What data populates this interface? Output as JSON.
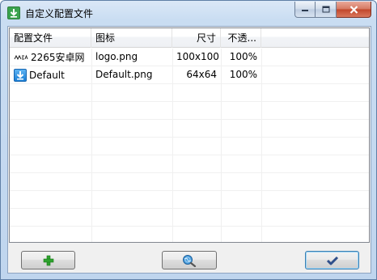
{
  "window": {
    "title": "自定义配置文件"
  },
  "table": {
    "columns": [
      "配置文件",
      "图标",
      "尺寸",
      "不透..."
    ],
    "rows": [
      {
        "name": "2265安卓网",
        "icon_file": "logo.png",
        "size": "100x100",
        "opacity": "100%",
        "icon": "site-logo-icon"
      },
      {
        "name": "Default",
        "icon_file": "Default.png",
        "size": "64x64",
        "opacity": "100%",
        "icon": "blue-download-arrow-icon"
      }
    ]
  },
  "buttons": {
    "add_icon": "green-plus-icon",
    "search_icon": "magnifier-globe-icon",
    "ok_icon": "checkmark-icon"
  },
  "colors": {
    "title_bar": "#c9ddf2",
    "close_button": "#c1452a",
    "add_icon": "#2ea32e",
    "ok_icon": "#2f4f8a"
  }
}
